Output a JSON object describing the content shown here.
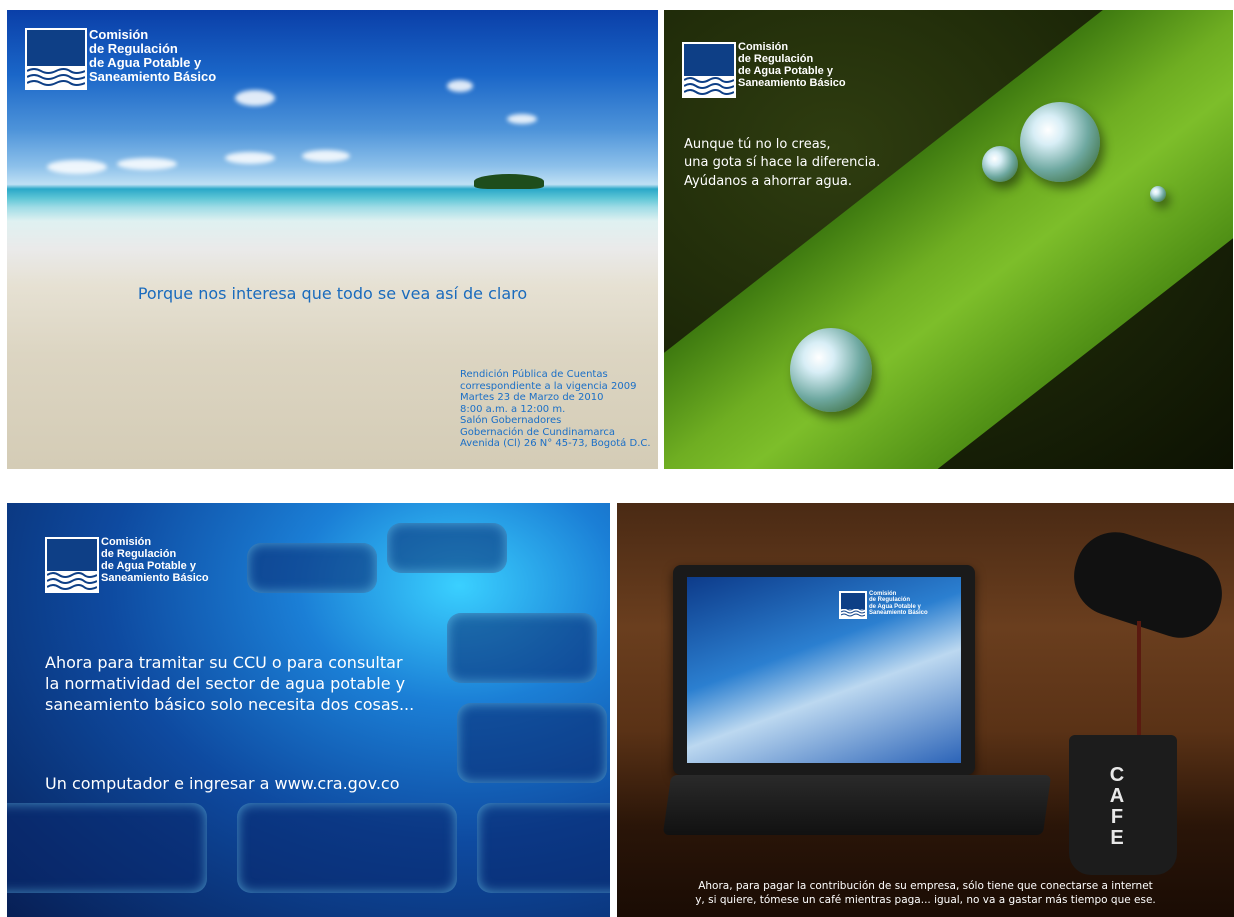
{
  "logo": {
    "name_lines": [
      "Comisión",
      "de Regulación",
      "de Agua Potable y",
      "Saneamiento Básico"
    ]
  },
  "panel_beach": {
    "tagline": "Porque nos interesa que todo se vea así de claro",
    "info_lines": [
      "Rendición Pública de Cuentas",
      "correspondiente a la vigencia 2009",
      "Martes 23 de Marzo de 2010",
      "8:00 a.m. a 12:00 m.",
      "Salón Gobernadores",
      "Gobernación de Cundinamarca",
      "Avenida (Cl) 26 N° 45-73, Bogotá D.C."
    ]
  },
  "panel_leaf": {
    "message_lines": [
      "Aunque tú no lo creas,",
      "una gota sí hace la diferencia.",
      "Ayúdanos a ahorrar agua."
    ]
  },
  "panel_keyboard": {
    "message_lines": [
      "Ahora para tramitar su CCU o para consultar",
      "la normatividad del sector de agua potable y",
      "saneamiento básico solo necesita dos cosas..."
    ],
    "url_line": "Un computador e ingresar a www.cra.gov.co"
  },
  "panel_coffee": {
    "message_lines": [
      "Ahora, para pagar la contribución de su empresa, sólo tiene que conectarse a internet",
      "y, si quiere, tómese un café mientras paga... igual, no va a gastar más tiempo que ese."
    ],
    "mug_letters": [
      "C",
      "A",
      "F",
      "E"
    ]
  }
}
